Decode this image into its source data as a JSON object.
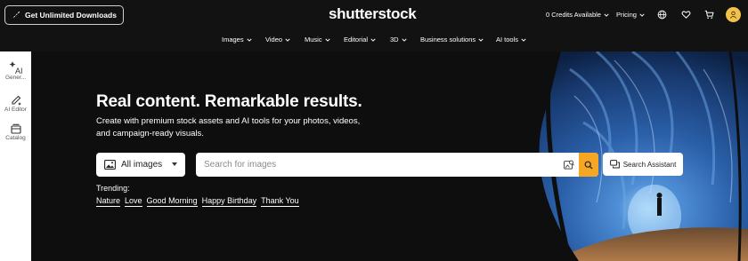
{
  "header": {
    "cta_label": "Get Unlimited Downloads",
    "logo": "shutterstock",
    "credits_label": "0 Credits Available",
    "pricing_label": "Pricing",
    "icons": [
      "globe-icon",
      "heart-icon",
      "cart-icon",
      "user-icon"
    ]
  },
  "nav": {
    "items": [
      {
        "label": "Images"
      },
      {
        "label": "Video"
      },
      {
        "label": "Music"
      },
      {
        "label": "Editorial"
      },
      {
        "label": "3D"
      },
      {
        "label": "Business solutions"
      },
      {
        "label": "AI tools"
      }
    ]
  },
  "sidebar": {
    "items": [
      {
        "label": "Gener...",
        "icon": "ai-sparkle-icon"
      },
      {
        "label": "AI Editor",
        "icon": "ai-editor-icon"
      },
      {
        "label": "Catalog",
        "icon": "catalog-icon"
      }
    ]
  },
  "hero": {
    "headline": "Real content. Remarkable results.",
    "subline": "Create with premium stock assets and AI tools for your photos, videos, and campaign-ready visuals.",
    "asset_select": "All images",
    "search_placeholder": "Search for images",
    "assistant_label": "Search Assistant",
    "trending_label": "Trending:",
    "trending": [
      "Nature",
      "Love",
      "Good Morning",
      "Happy Birthday",
      "Thank You"
    ]
  },
  "colors": {
    "background": "#121212",
    "accent": "#f5a623",
    "avatar": "#f2c14a",
    "art_blue": "#2f6fc0"
  }
}
